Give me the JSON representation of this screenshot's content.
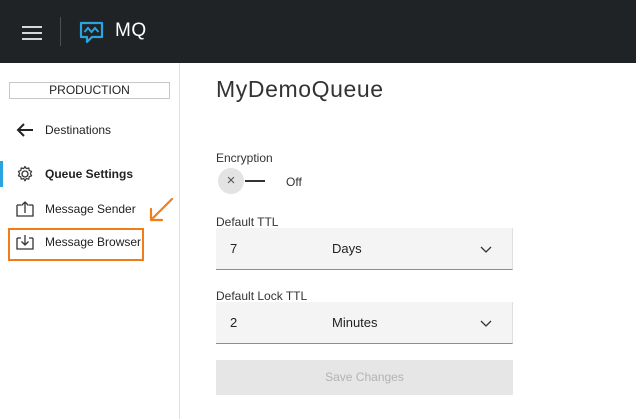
{
  "header": {
    "app_title": "MQ",
    "menu_icon": "hamburger-icon",
    "logo_icon": "mq-logo-icon",
    "background_color": "#1f2326"
  },
  "sidebar": {
    "environment": "PRODUCTION",
    "items": [
      {
        "label": "Destinations",
        "icon": "arrow-left-icon",
        "active": false
      },
      {
        "label": "Queue Settings",
        "icon": "gear-icon",
        "active": true
      },
      {
        "label": "Message Sender",
        "icon": "upload-tray-icon",
        "active": false
      },
      {
        "label": "Message Browser",
        "icon": "download-tray-icon",
        "active": false
      }
    ],
    "active_color": "#2aa3e0",
    "annotation_color": "#f07d1a"
  },
  "main": {
    "title": "MyDemoQueue",
    "encryption": {
      "label": "Encryption",
      "state": "Off",
      "toggle_symbol": "×"
    },
    "default_ttl": {
      "label": "Default TTL",
      "value": "7",
      "unit": "Days"
    },
    "default_lock_ttl": {
      "label": "Default Lock TTL",
      "value": "2",
      "unit": "Minutes"
    },
    "save_button": "Save Changes"
  }
}
